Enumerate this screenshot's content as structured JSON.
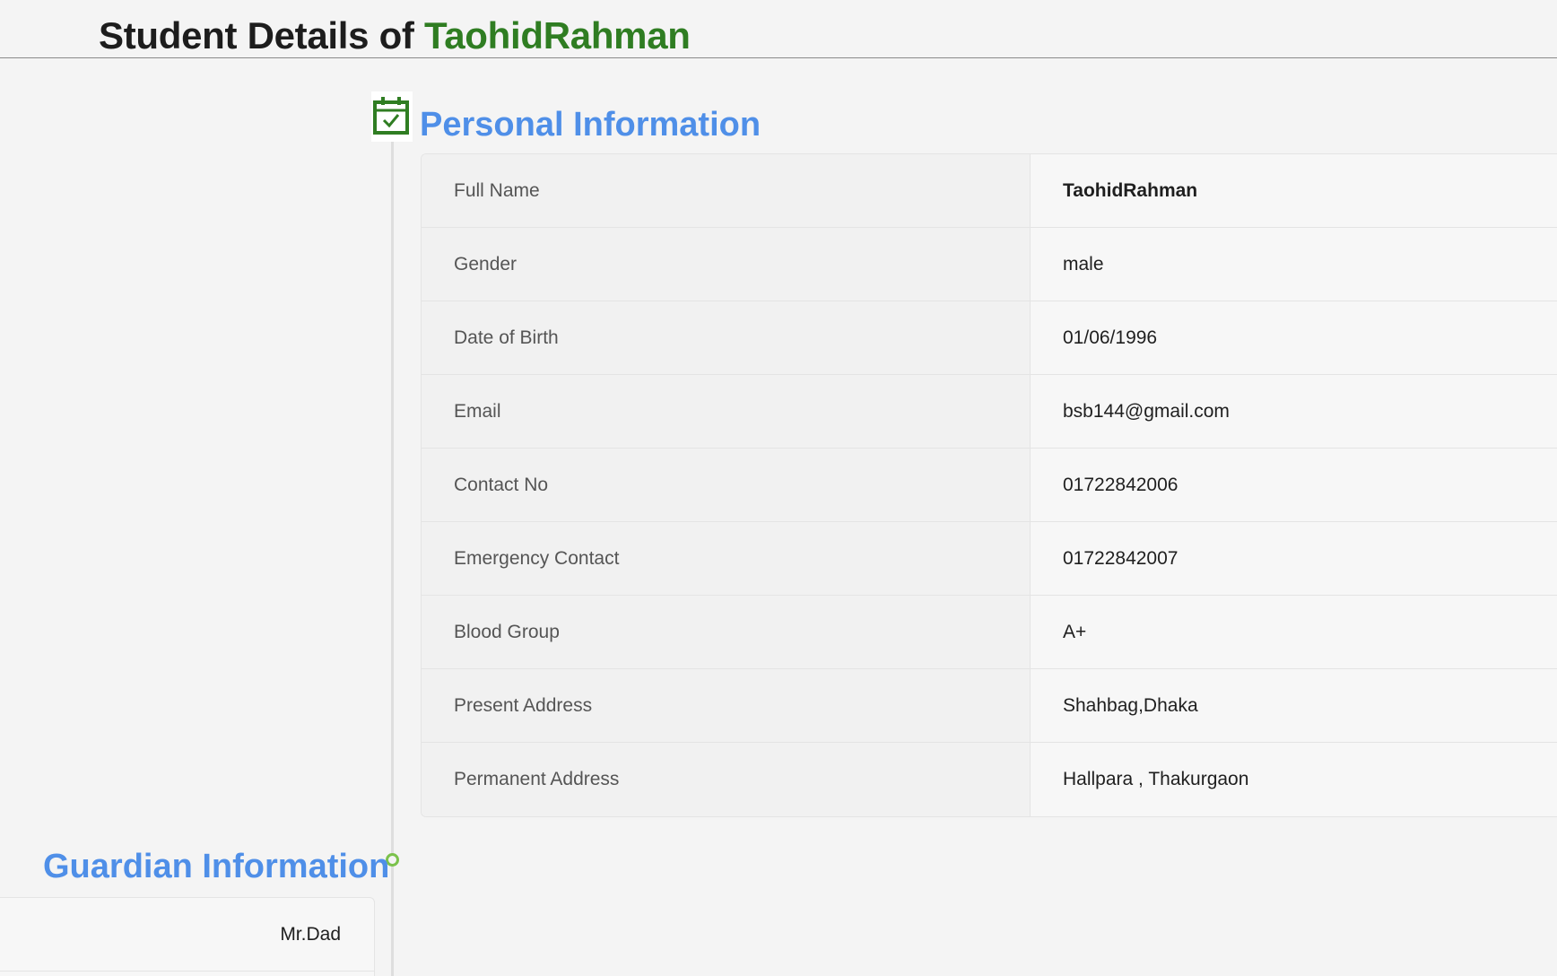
{
  "header": {
    "title_prefix": "Student Details of",
    "student_name": "TaohidRahman"
  },
  "personal": {
    "heading": "Personal Information",
    "icon": "calendar-check-icon",
    "rows": [
      {
        "label": "Full Name",
        "value": "TaohidRahman"
      },
      {
        "label": "Gender",
        "value": "male"
      },
      {
        "label": "Date of Birth",
        "value": "01/06/1996"
      },
      {
        "label": "Email",
        "value": "bsb144@gmail.com"
      },
      {
        "label": "Contact No",
        "value": "01722842006"
      },
      {
        "label": "Emergency Contact",
        "value": "01722842007"
      },
      {
        "label": "Blood Group",
        "value": "A+"
      },
      {
        "label": "Present Address",
        "value": "Shahbag,Dhaka"
      },
      {
        "label": "Permanent Address",
        "value": "Hallpara , Thakurgaon"
      }
    ]
  },
  "guardian": {
    "heading": "Guardian Information",
    "rows": [
      {
        "value": "Mr.Dad"
      }
    ]
  },
  "colors": {
    "heading_blue": "#4f8fe8",
    "name_green": "#2f7d22",
    "timeline_dot_green": "#7bc24c"
  }
}
